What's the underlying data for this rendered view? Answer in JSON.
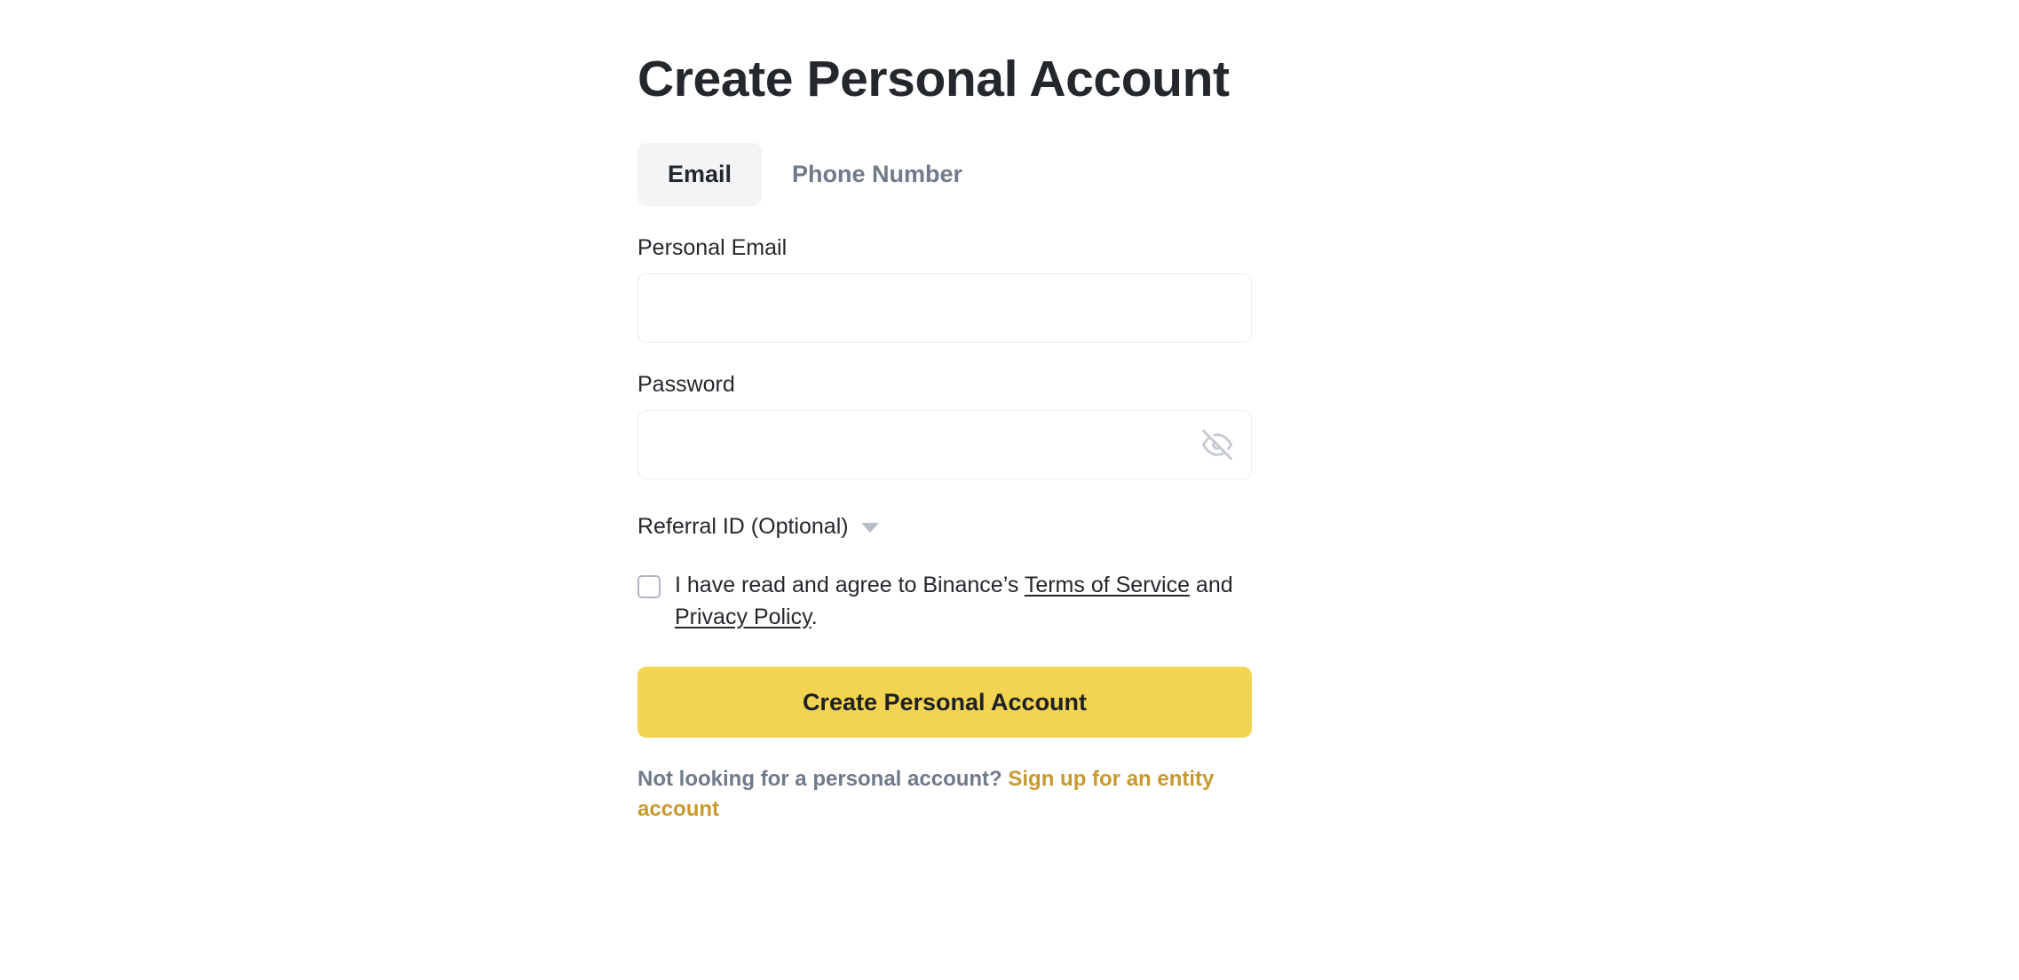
{
  "page": {
    "title": "Create Personal Account",
    "background_color": "#ffffff"
  },
  "tabs": {
    "active": "Email",
    "items": [
      {
        "label": "Email",
        "active": true
      },
      {
        "label": "Phone Number",
        "active": false
      }
    ]
  },
  "form": {
    "email": {
      "label": "Personal Email",
      "value": "",
      "placeholder": ""
    },
    "password": {
      "label": "Password",
      "value": "",
      "placeholder": "",
      "visibility_icon": "eye-off-icon",
      "visibility_state": "hidden"
    },
    "referral": {
      "label": "Referral ID (Optional)",
      "caret_icon": "chevron-down-icon",
      "expanded": false
    },
    "terms": {
      "checked": false,
      "text_before": "I have read and agree to Binance’s ",
      "link_terms": "Terms of Service",
      "text_between": " and ",
      "link_privacy": "Privacy Policy",
      "text_after": "."
    },
    "submit_label": "Create Personal Account"
  },
  "footer": {
    "prompt": "Not looking for a personal account? ",
    "link": "Sign up for an entity account"
  },
  "colors": {
    "accent_yellow": "#f2d352",
    "link_gold": "#c8992e",
    "text_primary": "#24272c",
    "text_muted": "#707a8a",
    "border": "#eaecef",
    "tab_active_bg": "#f3f4f5"
  }
}
